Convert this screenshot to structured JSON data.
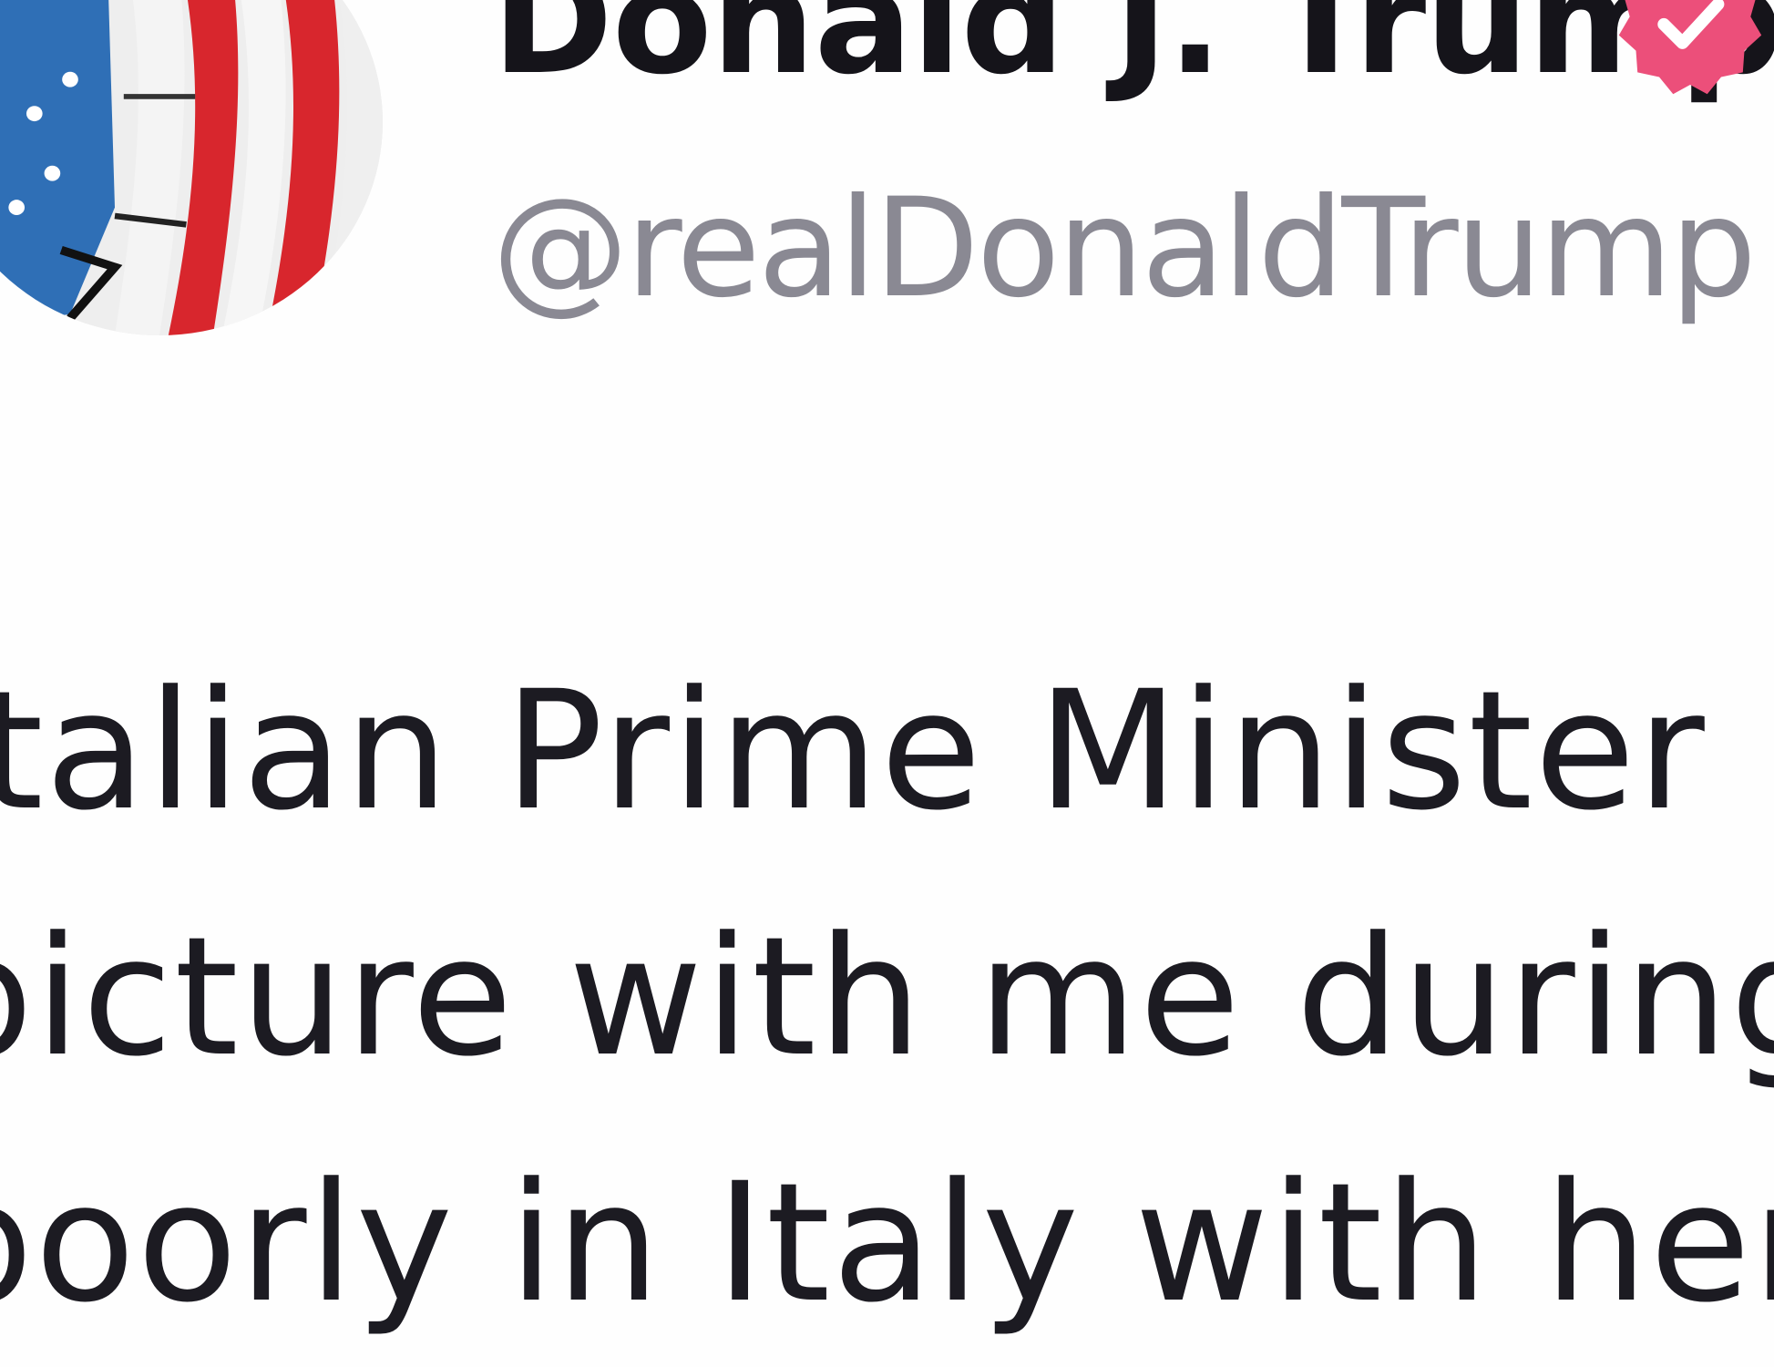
{
  "post": {
    "author": {
      "display_name": "Donald J. Trump",
      "handle": "@realDonaldTrump",
      "verified_icon": "verified-check-icon",
      "avatar": "american-flag-portrait"
    },
    "body_lines": [
      "Italian Prime Minister",
      "picture with me during",
      "poorly in Italy with her"
    ]
  },
  "colors": {
    "verified_badge": "#ec4f7a",
    "display_name": "#15141a",
    "handle": "#8a8993",
    "body_text": "#1c1b22",
    "background": "#fefefe"
  }
}
